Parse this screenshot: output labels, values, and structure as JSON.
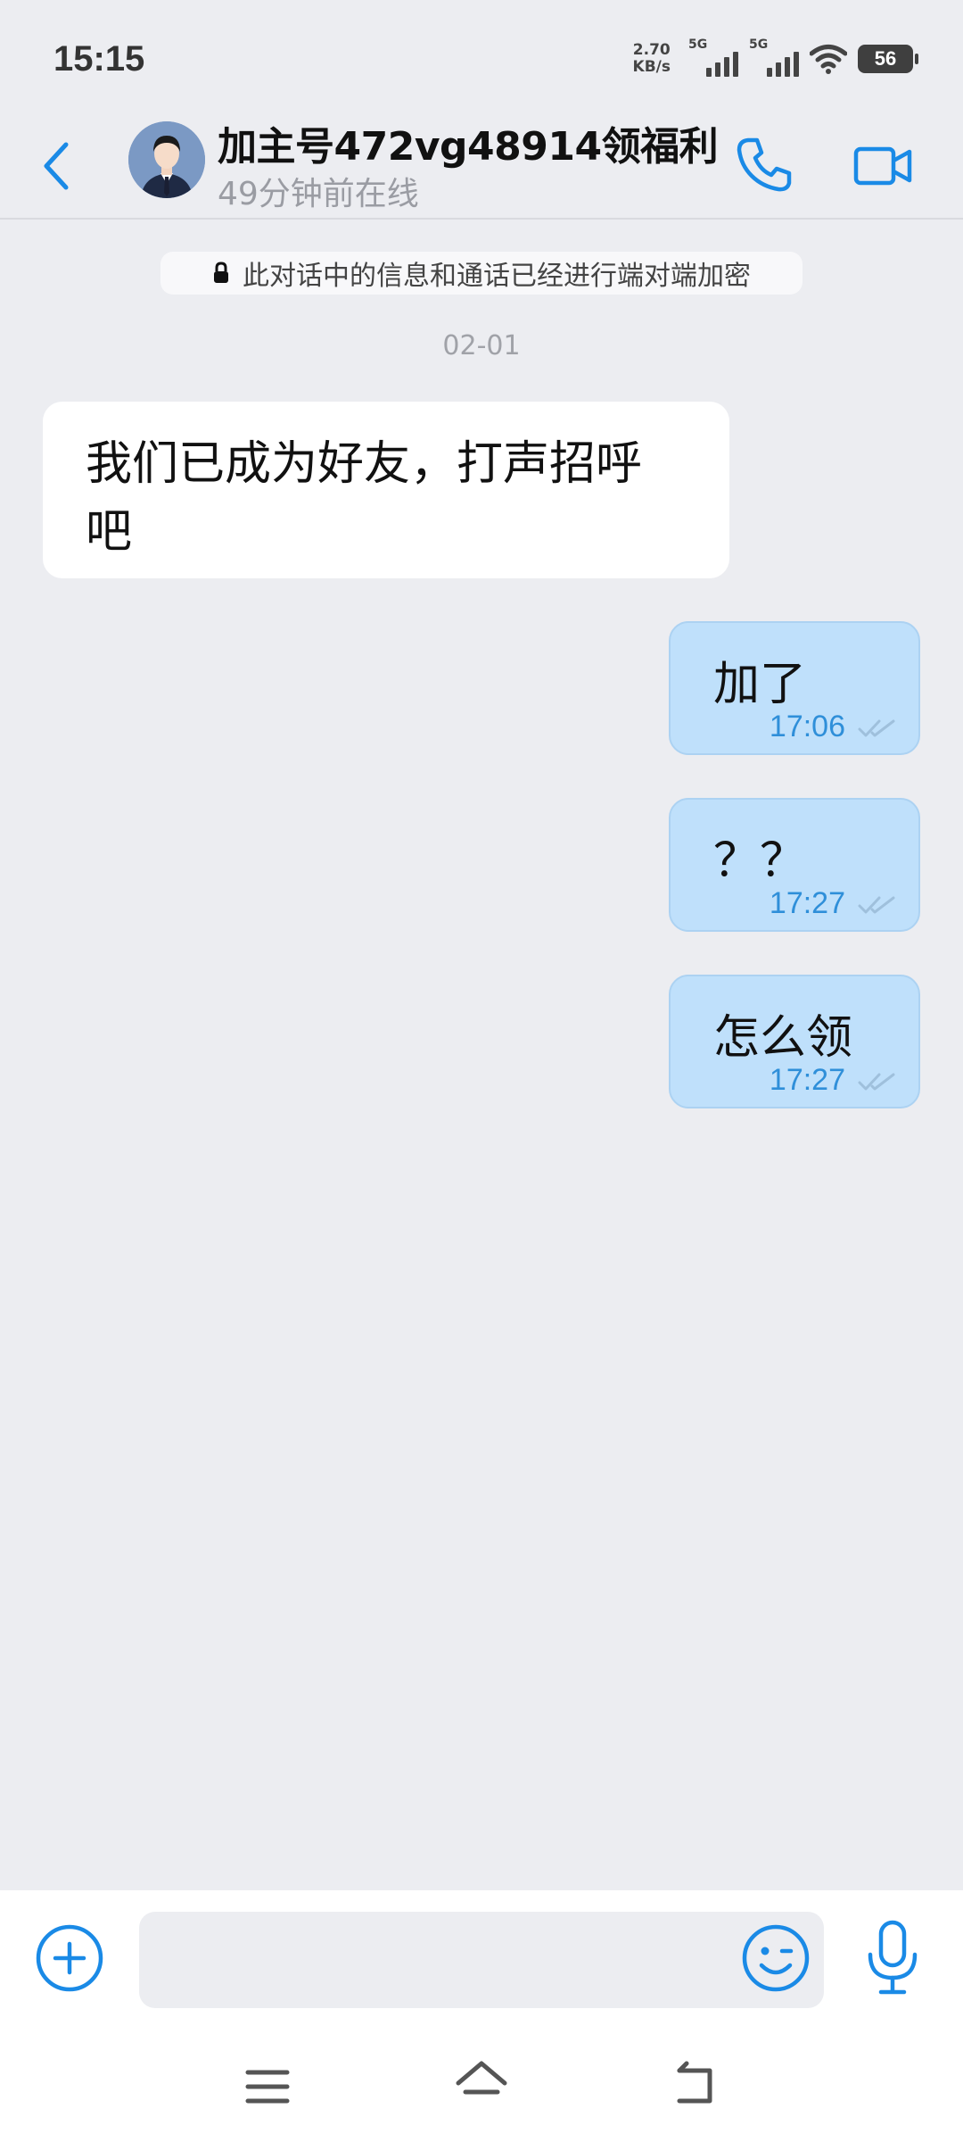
{
  "status_bar": {
    "time": "15:15",
    "net_speed_value": "2.70",
    "net_speed_unit": "KB/s",
    "sim1_tag": "5G",
    "sim2_tag": "5G",
    "battery": "56"
  },
  "header": {
    "contact_name": "加主号472vg48914领福利",
    "contact_status": "49分钟前在线"
  },
  "conversation": {
    "encryption_notice": "此对话中的信息和通话已经进行端对端加密",
    "date": "02-01",
    "messages": [
      {
        "direction": "in",
        "text": "我们已成为好友，打声招呼吧"
      },
      {
        "direction": "out",
        "text": "加了",
        "time": "17:06",
        "status": "read"
      },
      {
        "direction": "out",
        "text": "？？",
        "time": "17:27",
        "status": "read"
      },
      {
        "direction": "out",
        "text": "怎么领",
        "time": "17:27",
        "status": "read"
      }
    ]
  },
  "input": {
    "placeholder": ""
  },
  "icons": {
    "back": "chevron-left-icon",
    "call": "phone-icon",
    "video": "video-camera-icon",
    "lock": "lock-icon",
    "attach": "plus-circle-icon",
    "emoji": "smiley-icon",
    "voice": "microphone-icon",
    "read_receipt": "double-check-icon"
  },
  "colors": {
    "accent": "#1a8ae6",
    "outgoing_bubble": "#bfe0fb",
    "incoming_bubble": "#ffffff",
    "background": "#ecedf1",
    "time_text": "#2f8fd9"
  }
}
